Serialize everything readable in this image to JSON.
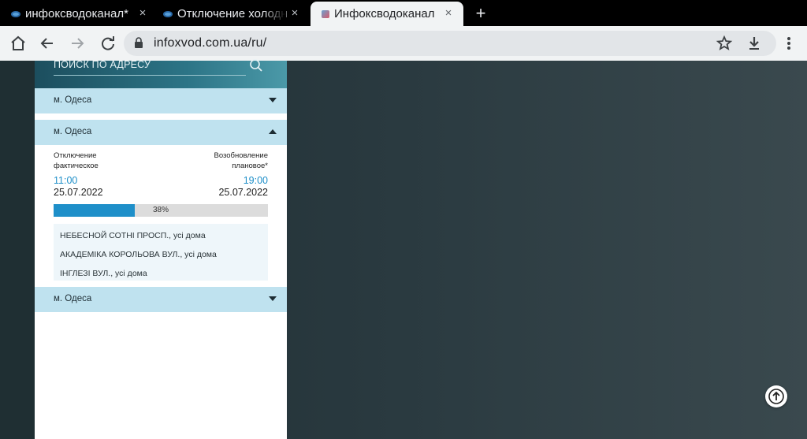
{
  "tabs": [
    {
      "title": "инфоксводоканал*",
      "favicon": "eye-icon",
      "close": "×"
    },
    {
      "title": "Отключение холодно",
      "favicon": "eye-icon",
      "close": "×"
    },
    {
      "title": "Инфоксводоканал",
      "favicon": "site-logo-icon",
      "close": "×",
      "active": true
    }
  ],
  "new_tab_label": "+",
  "toolbar": {
    "url": "infoxvod.com.ua/ru/"
  },
  "search": {
    "label": "ПОИСК ПО АДРЕСУ"
  },
  "accordions": [
    {
      "label": "м. Одеса",
      "state": "collapsed"
    },
    {
      "label": "м. Одеса",
      "state": "expanded"
    },
    {
      "label": "м. Одеса",
      "state": "collapsed"
    }
  ],
  "outage": {
    "off_label_line1": "Отключение",
    "off_label_line2": "фактическое",
    "on_label_line1": "Возобновление",
    "on_label_line2": "плановое*",
    "off_time": "11:00",
    "off_date": "25.07.2022",
    "on_time": "19:00",
    "on_date": "25.07.2022",
    "progress_pct": 38,
    "progress_label": "38%",
    "streets": [
      "НЕБЕСНОЙ СОТНІ ПРОСП., усі дома",
      "АКАДЕМІКА КОРОЛЬОВА ВУЛ., усі дома",
      "ІНГЛЕЗІ ВУЛ., усі дома"
    ]
  },
  "colors": {
    "accent": "#1e8fc9",
    "accordion": "#bfe2ef",
    "header_gradient_start": "#1c4e5e"
  }
}
